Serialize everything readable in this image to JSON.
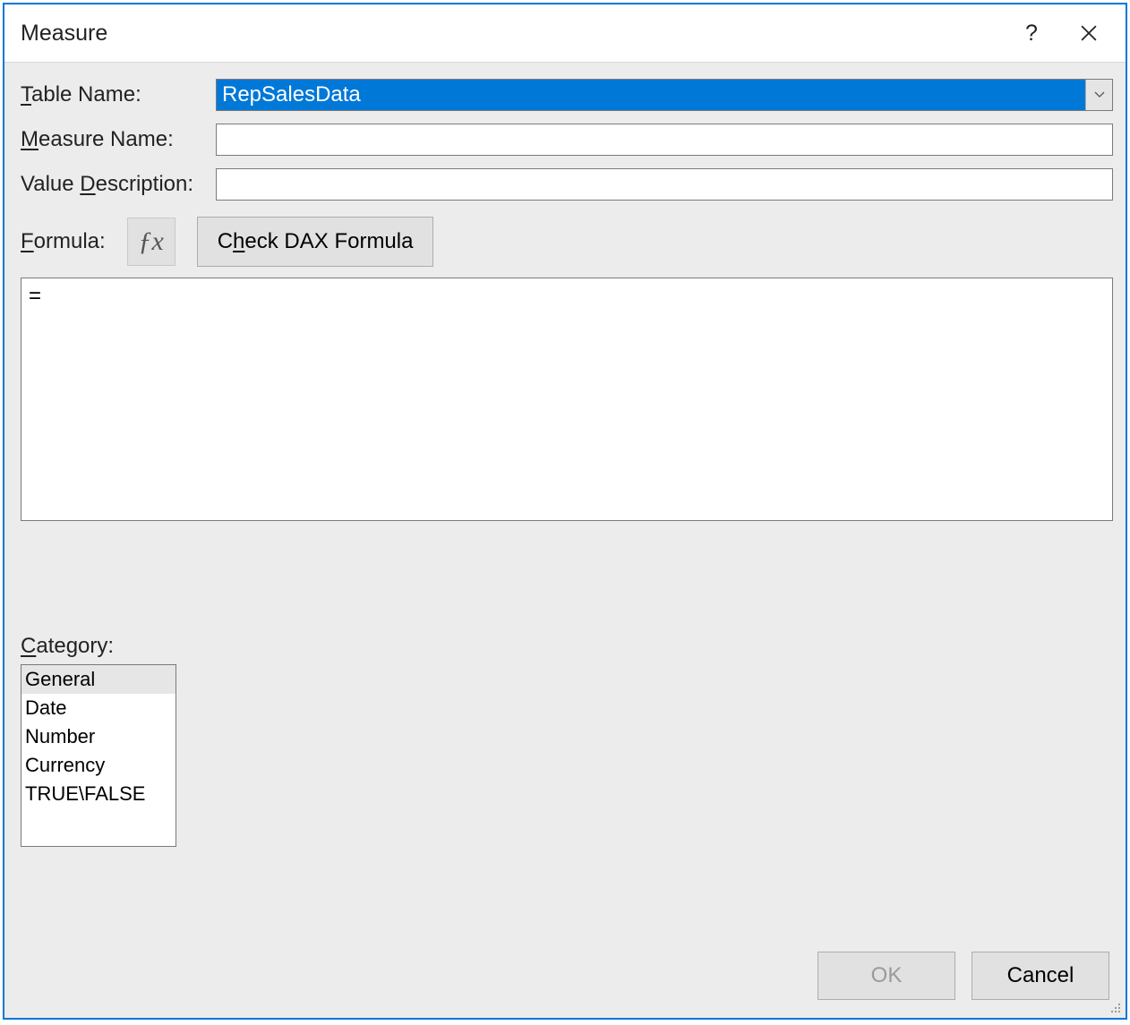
{
  "dialog": {
    "title": "Measure"
  },
  "labels": {
    "table_name_pre": "T",
    "table_name_rest": "able Name:",
    "measure_name_pre": "M",
    "measure_name_rest": "easure Name:",
    "value_desc_before": "Value ",
    "value_desc_ul": "D",
    "value_desc_after": "escription:",
    "formula_pre": "F",
    "formula_rest": "ormula:",
    "check_pre": "C",
    "check_ul": "h",
    "check_rest": "eck DAX Formula",
    "category_pre": "C",
    "category_rest": "ategory:"
  },
  "fields": {
    "table_name": "RepSalesData",
    "measure_name": "",
    "value_description": "",
    "formula": "="
  },
  "fx_label": "ƒx",
  "categories": {
    "items": [
      "General",
      "Date",
      "Number",
      "Currency",
      "TRUE\\FALSE"
    ],
    "selected_index": 0
  },
  "buttons": {
    "ok": "OK",
    "cancel": "Cancel"
  }
}
